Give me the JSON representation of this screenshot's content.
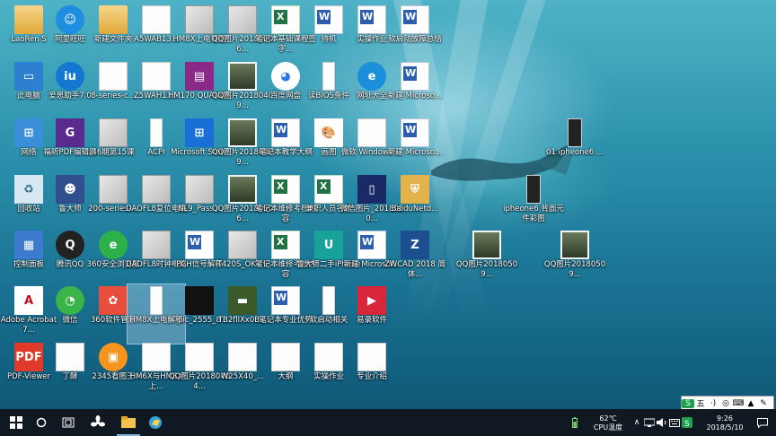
{
  "desktop": {
    "icons": [
      {
        "label": "LaoRen S",
        "type": "folder",
        "col": 0,
        "row": 0
      },
      {
        "label": "此电脑",
        "type": "pc",
        "col": 0,
        "row": 1
      },
      {
        "label": "网络",
        "type": "network",
        "col": 0,
        "row": 2
      },
      {
        "label": "回收站",
        "type": "recycle",
        "col": 0,
        "row": 3
      },
      {
        "label": "控制面板",
        "type": "control",
        "col": 0,
        "row": 4
      },
      {
        "label": "Adobe Acrobat 7...",
        "type": "pdf",
        "col": 0,
        "row": 5
      },
      {
        "label": "PDF-Viewer",
        "type": "pdfviewer",
        "col": 0,
        "row": 6
      },
      {
        "label": "阿里旺旺",
        "type": "wangwang",
        "col": 1,
        "row": 0
      },
      {
        "label": "爱思助手7.0",
        "type": "aisi",
        "col": 1,
        "row": 1
      },
      {
        "label": "福昕PDF编辑器",
        "type": "foxit",
        "col": 1,
        "row": 2
      },
      {
        "label": "鲁大师",
        "type": "ludashi",
        "col": 1,
        "row": 3
      },
      {
        "label": "腾讯QQ",
        "type": "qq",
        "col": 1,
        "row": 4
      },
      {
        "label": "微信",
        "type": "wechat",
        "col": 1,
        "row": 5
      },
      {
        "label": "丁酵",
        "type": "file",
        "col": 1,
        "row": 6
      },
      {
        "label": "新建文件夹",
        "type": "folder",
        "col": 2,
        "row": 0
      },
      {
        "label": "8-series-c...",
        "type": "file",
        "col": 2,
        "row": 1
      },
      {
        "label": "46期第15课",
        "type": "img",
        "col": 2,
        "row": 2
      },
      {
        "label": "200-series-...",
        "type": "img",
        "col": 2,
        "row": 3
      },
      {
        "label": "360安全浏览器",
        "type": "browser360",
        "col": 2,
        "row": 4
      },
      {
        "label": "360软件管家",
        "type": "soft360",
        "col": 2,
        "row": 5
      },
      {
        "label": "2345看图王",
        "type": "viewer2345",
        "col": 2,
        "row": 6
      },
      {
        "label": "A5WAB13...",
        "type": "file",
        "col": 3,
        "row": 0
      },
      {
        "label": "Z5WAH13...",
        "type": "file",
        "col": 3,
        "row": 1
      },
      {
        "label": "ACPI",
        "type": "narrow",
        "col": 3,
        "row": 2
      },
      {
        "label": "DAOFL8复位电路",
        "type": "img",
        "col": 3,
        "row": 3
      },
      {
        "label": "DAOFL8时钟电路",
        "type": "img",
        "col": 3,
        "row": 4
      },
      {
        "label": "HM8X上电解释",
        "type": "narrow",
        "col": 3,
        "row": 5,
        "selected": true
      },
      {
        "label": "HM6X与HM8X上...",
        "type": "file",
        "col": 3,
        "row": 6
      },
      {
        "label": "HM8X上电框图",
        "type": "img",
        "col": 4,
        "row": 0
      },
      {
        "label": "HM170 QUANDA",
        "type": "winrar",
        "col": 4,
        "row": 1
      },
      {
        "label": "Microsoft Store",
        "type": "store",
        "col": 4,
        "row": 2
      },
      {
        "label": "NL9_Pass...",
        "type": "img",
        "col": 4,
        "row": 3
      },
      {
        "label": "PCH信号解释",
        "type": "word",
        "col": 4,
        "row": 4
      },
      {
        "label": "pic_2555_8",
        "type": "dark",
        "col": 4,
        "row": 5
      },
      {
        "label": "QQ图片20180404...",
        "type": "file",
        "col": 4,
        "row": 6
      },
      {
        "label": "QQ图片20180406...",
        "type": "img",
        "col": 5,
        "row": 0
      },
      {
        "label": "QQ图片20180409...",
        "type": "photo",
        "col": 5,
        "row": 1
      },
      {
        "label": "QQ图片20180409...",
        "type": "photo",
        "col": 5,
        "row": 2
      },
      {
        "label": "QQ图片20180506...",
        "type": "photo",
        "col": 5,
        "row": 3
      },
      {
        "label": "T420S_OK 76",
        "type": "img",
        "col": 5,
        "row": 4
      },
      {
        "label": "TB2fllXx0B...",
        "type": "board",
        "col": 5,
        "row": 5
      },
      {
        "label": "W25X40_...",
        "type": "file",
        "col": 5,
        "row": 6
      },
      {
        "label": "笔记本基础课程签字...",
        "type": "xls",
        "col": 6,
        "row": 0
      },
      {
        "label": "百度网盘",
        "type": "baidupan",
        "col": 6,
        "row": 1
      },
      {
        "label": "笔记本教学大纲",
        "type": "word",
        "col": 6,
        "row": 2
      },
      {
        "label": "笔记本维修考核内容",
        "type": "xls",
        "col": 6,
        "row": 3
      },
      {
        "label": "笔记本维修考核内容",
        "type": "xls",
        "col": 6,
        "row": 4
      },
      {
        "label": "笔记本专业优势",
        "type": "word",
        "col": 6,
        "row": 5
      },
      {
        "label": "大纲",
        "type": "file",
        "col": 6,
        "row": 6
      },
      {
        "label": "待机",
        "type": "word",
        "col": 7,
        "row": 0
      },
      {
        "label": "读BIOS条件",
        "type": "narrow",
        "col": 7,
        "row": 1
      },
      {
        "label": "画图",
        "type": "paint",
        "col": 7,
        "row": 2
      },
      {
        "label": "兼职人员名单",
        "type": "xls",
        "col": 7,
        "row": 3
      },
      {
        "label": "鲁大师二手iPhone",
        "type": "ludashi2",
        "col": 7,
        "row": 4
      },
      {
        "label": "软启动相关",
        "type": "narrow",
        "col": 7,
        "row": 5
      },
      {
        "label": "实操作业",
        "type": "file",
        "col": 7,
        "row": 6
      },
      {
        "label": "实操作业",
        "type": "word",
        "col": 8,
        "row": 0
      },
      {
        "label": "网址大全",
        "type": "ie",
        "col": 8,
        "row": 1
      },
      {
        "label": "微软 Windows ...",
        "type": "file",
        "col": 8,
        "row": 2
      },
      {
        "label": "微信图片_2018050...",
        "type": "phone",
        "col": 8,
        "row": 3
      },
      {
        "label": "新建 Microsof...",
        "type": "word",
        "col": 8,
        "row": 4
      },
      {
        "label": "易录软件",
        "type": "recorder",
        "col": 8,
        "row": 5
      },
      {
        "label": "专业介绍",
        "type": "file",
        "col": 8,
        "row": 6
      },
      {
        "label": "软启动故障总结",
        "type": "word",
        "col": 9,
        "row": 0
      },
      {
        "label": "新建 Microso...",
        "type": "word",
        "col": 9,
        "row": 1
      },
      {
        "label": "新建 Microso...",
        "type": "word",
        "col": 9,
        "row": 2
      },
      {
        "label": "BaiduNetd...",
        "type": "baidunetd",
        "col": 9,
        "row": 3
      },
      {
        "label": "ZWCAD 2018 简体...",
        "type": "zwcad",
        "col": 9,
        "row": 4
      }
    ],
    "extra_icons": [
      {
        "label": "01 ipheone6 ...",
        "type": "narrow2",
        "col": "x12",
        "row": 2
      },
      {
        "label": "ipheone6 背面元件彩图",
        "type": "narrow2",
        "col": "x11",
        "row": 3
      },
      {
        "label": "QQ图片20180509...",
        "type": "photo",
        "col": "x10",
        "row": 4
      },
      {
        "label": "QQ图片20180509...",
        "type": "photo",
        "col": "x12",
        "row": 4
      }
    ]
  },
  "taskbar": {
    "start_icon": "windows-start",
    "search_icon": "cortana-circle",
    "taskview_icon": "task-view",
    "pinned": [
      "fan-app",
      "file-explorer",
      "parrot-app"
    ],
    "tray": {
      "temp_value": "62℃",
      "temp_label": "CPU温度",
      "time": "9:26",
      "date": "2018/5/10"
    }
  },
  "ime_bar": {
    "items": [
      "S",
      "五",
      "·)",
      "◎",
      "⌨",
      "👕",
      "✎"
    ]
  },
  "colors": {
    "taskbar": "#101822",
    "selection": "rgba(200,230,255,0.35)"
  }
}
